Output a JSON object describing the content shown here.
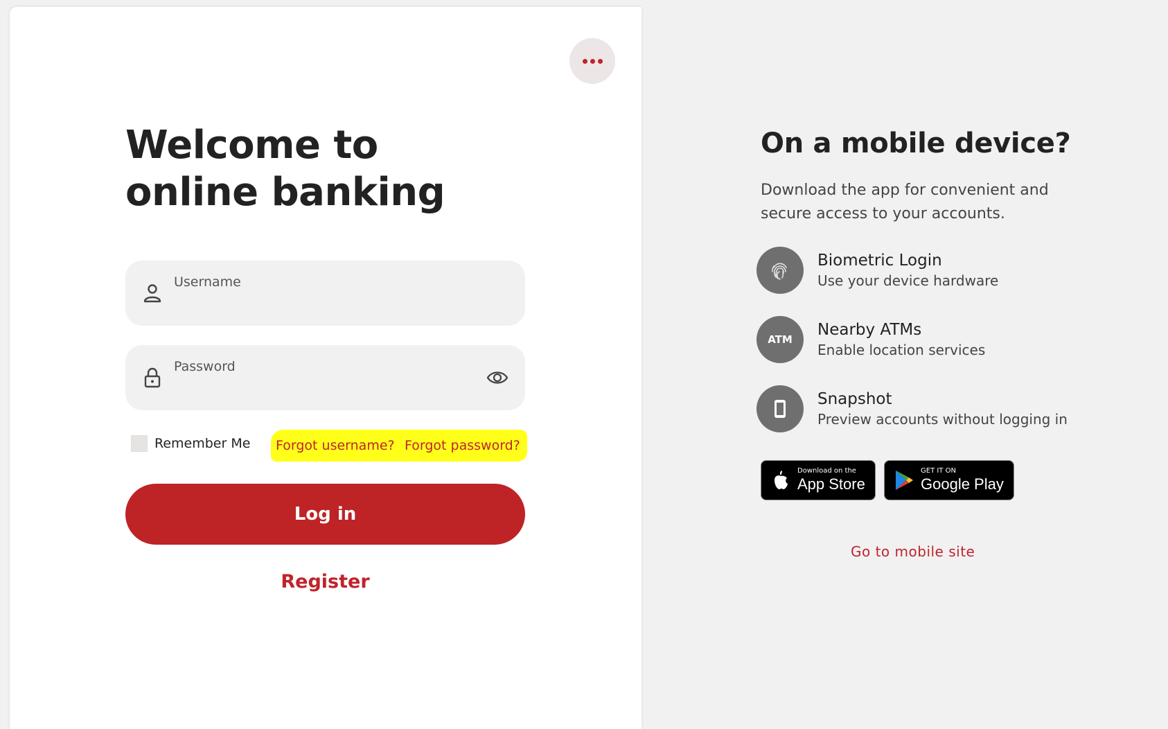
{
  "login": {
    "title": "Welcome to online banking",
    "username_label": "Username",
    "password_label": "Password",
    "remember_label": "Remember Me",
    "forgot_username": "Forgot username?",
    "forgot_password": "Forgot password?",
    "login_button": "Log in",
    "register_link": "Register"
  },
  "mobile": {
    "title": "On a mobile device?",
    "description": "Download the app for convenient and secure access to your accounts.",
    "features": [
      {
        "name": "Biometric Login",
        "desc": "Use your device hardware",
        "icon": "fingerprint-icon"
      },
      {
        "name": "Nearby ATMs",
        "desc": "Enable location services",
        "icon": "atm-icon",
        "icon_text": "ATM"
      },
      {
        "name": "Snapshot",
        "desc": "Preview accounts without logging in",
        "icon": "phone-icon"
      }
    ],
    "app_store": {
      "small": "Download on the",
      "big": "App Store"
    },
    "google_play": {
      "small": "GET IT ON",
      "big": "Google Play"
    },
    "mobile_site_link": "Go to mobile site"
  },
  "colors": {
    "brand_red": "#be2326",
    "highlight": "#ffff1a",
    "panel_bg": "#f1f1f1"
  }
}
